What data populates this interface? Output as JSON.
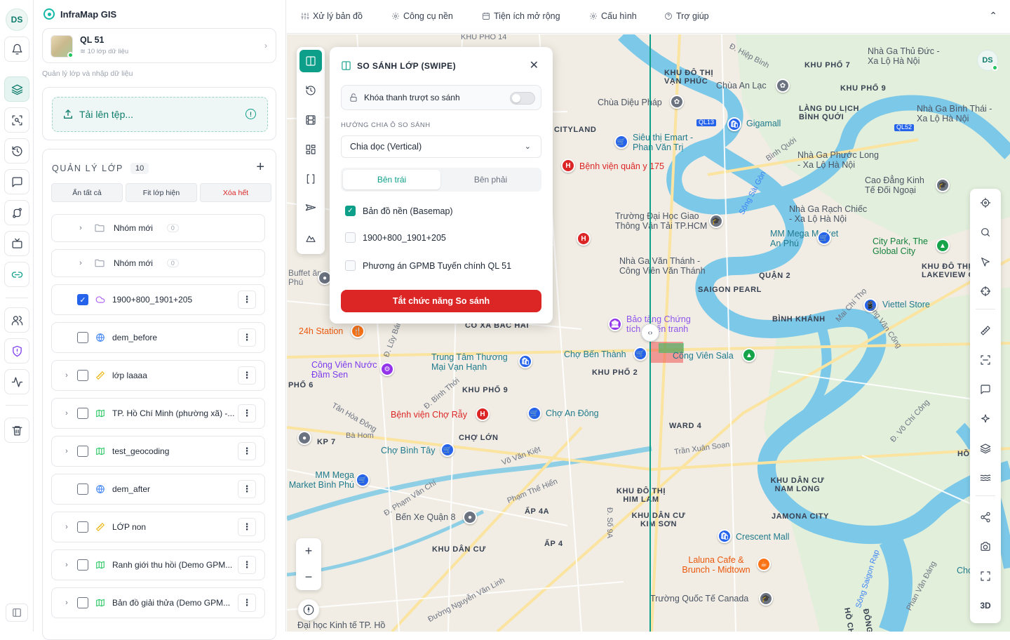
{
  "user_initials": "DS",
  "app": {
    "name": "InfraMap GIS"
  },
  "project": {
    "name": "QL 51",
    "sublabel": "10 lớp dữ liệu"
  },
  "panel_hint": "Quản lý lớp và nhập dữ liệu",
  "upload_label": "Tải lên tệp...",
  "layers_panel": {
    "title": "QUẢN LÝ LỚP",
    "count": "10",
    "actions": {
      "hide_all": "Ẩn tất cả",
      "fit": "Fit lớp hiện",
      "clear": "Xóa hết"
    },
    "groups": [
      {
        "name": "Nhóm mới",
        "count": "0"
      },
      {
        "name": "Nhóm mới",
        "count": "0"
      }
    ],
    "layers": [
      {
        "name": "1900+800_1901+205",
        "checked": true,
        "icon": "cloud-icon",
        "expandable": false
      },
      {
        "name": "dem_before",
        "checked": false,
        "icon": "globe-icon",
        "expandable": false
      },
      {
        "name": "lớp laaaa",
        "checked": false,
        "icon": "ruler-icon",
        "expandable": true
      },
      {
        "name": "TP. Hồ Chí Minh (phường xã) -...",
        "checked": false,
        "icon": "map-icon",
        "expandable": true
      },
      {
        "name": "test_geocoding",
        "checked": false,
        "icon": "map-icon",
        "expandable": true
      },
      {
        "name": "dem_after",
        "checked": false,
        "icon": "globe-icon",
        "expandable": false
      },
      {
        "name": "LỚP non",
        "checked": false,
        "icon": "ruler-icon",
        "expandable": true
      },
      {
        "name": "Ranh giới thu hồi (Demo GPM...",
        "checked": false,
        "icon": "map-icon",
        "expandable": true
      },
      {
        "name": "Bản đồ giải thửa (Demo GPM...",
        "checked": false,
        "icon": "map-icon",
        "expandable": true
      }
    ]
  },
  "topmenu": [
    "Xử lý bản đồ",
    "Công cụ nền",
    "Tiện ích mở rộng",
    "Cấu hình",
    "Trợ giúp"
  ],
  "swipe": {
    "title": "SO SÁNH LỚP (SWIPE)",
    "lock_label": "Khóa thanh trượt so sánh",
    "direction_label": "HƯỚNG CHIA Ô SO SÁNH",
    "direction_value": "Chia dọc (Vertical)",
    "tab_left": "Bên trái",
    "tab_right": "Bên phải",
    "options": [
      {
        "label": "Bản đồ nền (Basemap)",
        "checked": true
      },
      {
        "label": "1900+800_1901+205",
        "checked": false
      },
      {
        "label": "Phương án GPMB Tuyến chính QL 51",
        "checked": false
      }
    ],
    "off_button": "Tắt chức năng So sánh"
  },
  "map_labels": [
    "KHU PHỐ 14",
    "Nhà Ga Thủ Đức - Xa Lộ Hà Nội",
    "KHU PHỐ 7",
    "KHU ĐÔ THỊ VẠN PHÚC",
    "Chùa An Lạc",
    "KHU PHỐ 9",
    "Chùa Diệu Pháp",
    "LÀNG DU LỊCH BÌNH QUỚI",
    "Nhà Ga Bình Thái - Xa Lộ Hà Nội",
    "CITYLAND",
    "Gigamall",
    "Siêu thị Emart - Phan Văn Trị",
    "Bệnh viện quân y 175",
    "Nhà Ga Phước Long - Xa Lộ Hà Nội",
    "Cao Đẳng Kinh Tế Đối Ngoại",
    "Trường Đại Học Giao Thông Vận Tải TP.HCM",
    "Nhà Ga Rạch Chiếc - Xa Lộ Hà Nội",
    "MM Mega Market An Phú",
    "City Park, The Global City",
    "Nhà Ga Văn Thánh - Công Viên Văn Thánh",
    "QUẬN 2",
    "SAIGON PEARL",
    "KHU ĐÔ THỊ LAKEVIEW CI",
    "Viettel Store",
    "Buffet ăn Phú",
    "Bảo tàng Chứng tích Chiến tranh",
    "BÌNH KHÁNH",
    "CÔ XA BẮC HẢI",
    "24h Station",
    "Chợ Bến Thành",
    "Công Viên Sala",
    "KHU PHỐ 2",
    "Công Viên Nước Đầm Sen",
    "Trung Tâm Thương Mại Vạn Hạnh",
    "KHU PHỐ 9",
    "PHỐ 6",
    "Bệnh viện Chợ Rẫy",
    "Chợ An Đông",
    "WARD 4",
    "KP 7",
    "CHỢ LỚN",
    "Chợ Bình Tây",
    "Trần Xuân Soạn",
    "MM Mega Market Bình Phú",
    "KHU ĐÔ THỊ HIM LAM",
    "KHU DÂN CƯ NAM LONG",
    "Bến Xe Quận 8",
    "ẤP 4A",
    "KHU DÂN CƯ KIM SƠN",
    "JAMONA CITY",
    "KHU DÂN CƯ",
    "ẤP 4",
    "Crescent Mall",
    "Laluna Cafe & Brunch - Midtown",
    "Trường Quốc Tế Canada",
    "Đại học Kinh tế TP. Hồ",
    "QL13",
    "QL52",
    "Đ. Hiệp Bình",
    "Bình Quới",
    "Sông Sài Gòn",
    "Võ Văn Kiệt",
    "Phạm Thế Hiển",
    "Đ. Phạm Văn Chí",
    "Mai Chí Thọ",
    "Đồng Văn Cống",
    "Đ. Võ Chí Công",
    "Đường Nguyễn Văn Linh",
    "Bà Hom",
    "Tân Hòa Đông",
    "Đ. Bình Thới",
    "Đ. Lũy Bán",
    "Phan Văn Đáng",
    "Sông Saigon Rạp",
    "Đ. Số 9A",
    "Chợ",
    "HỒ",
    "ĐÔNG",
    "HỒ CH"
  ],
  "map_controls": {
    "three_d": "3D"
  }
}
